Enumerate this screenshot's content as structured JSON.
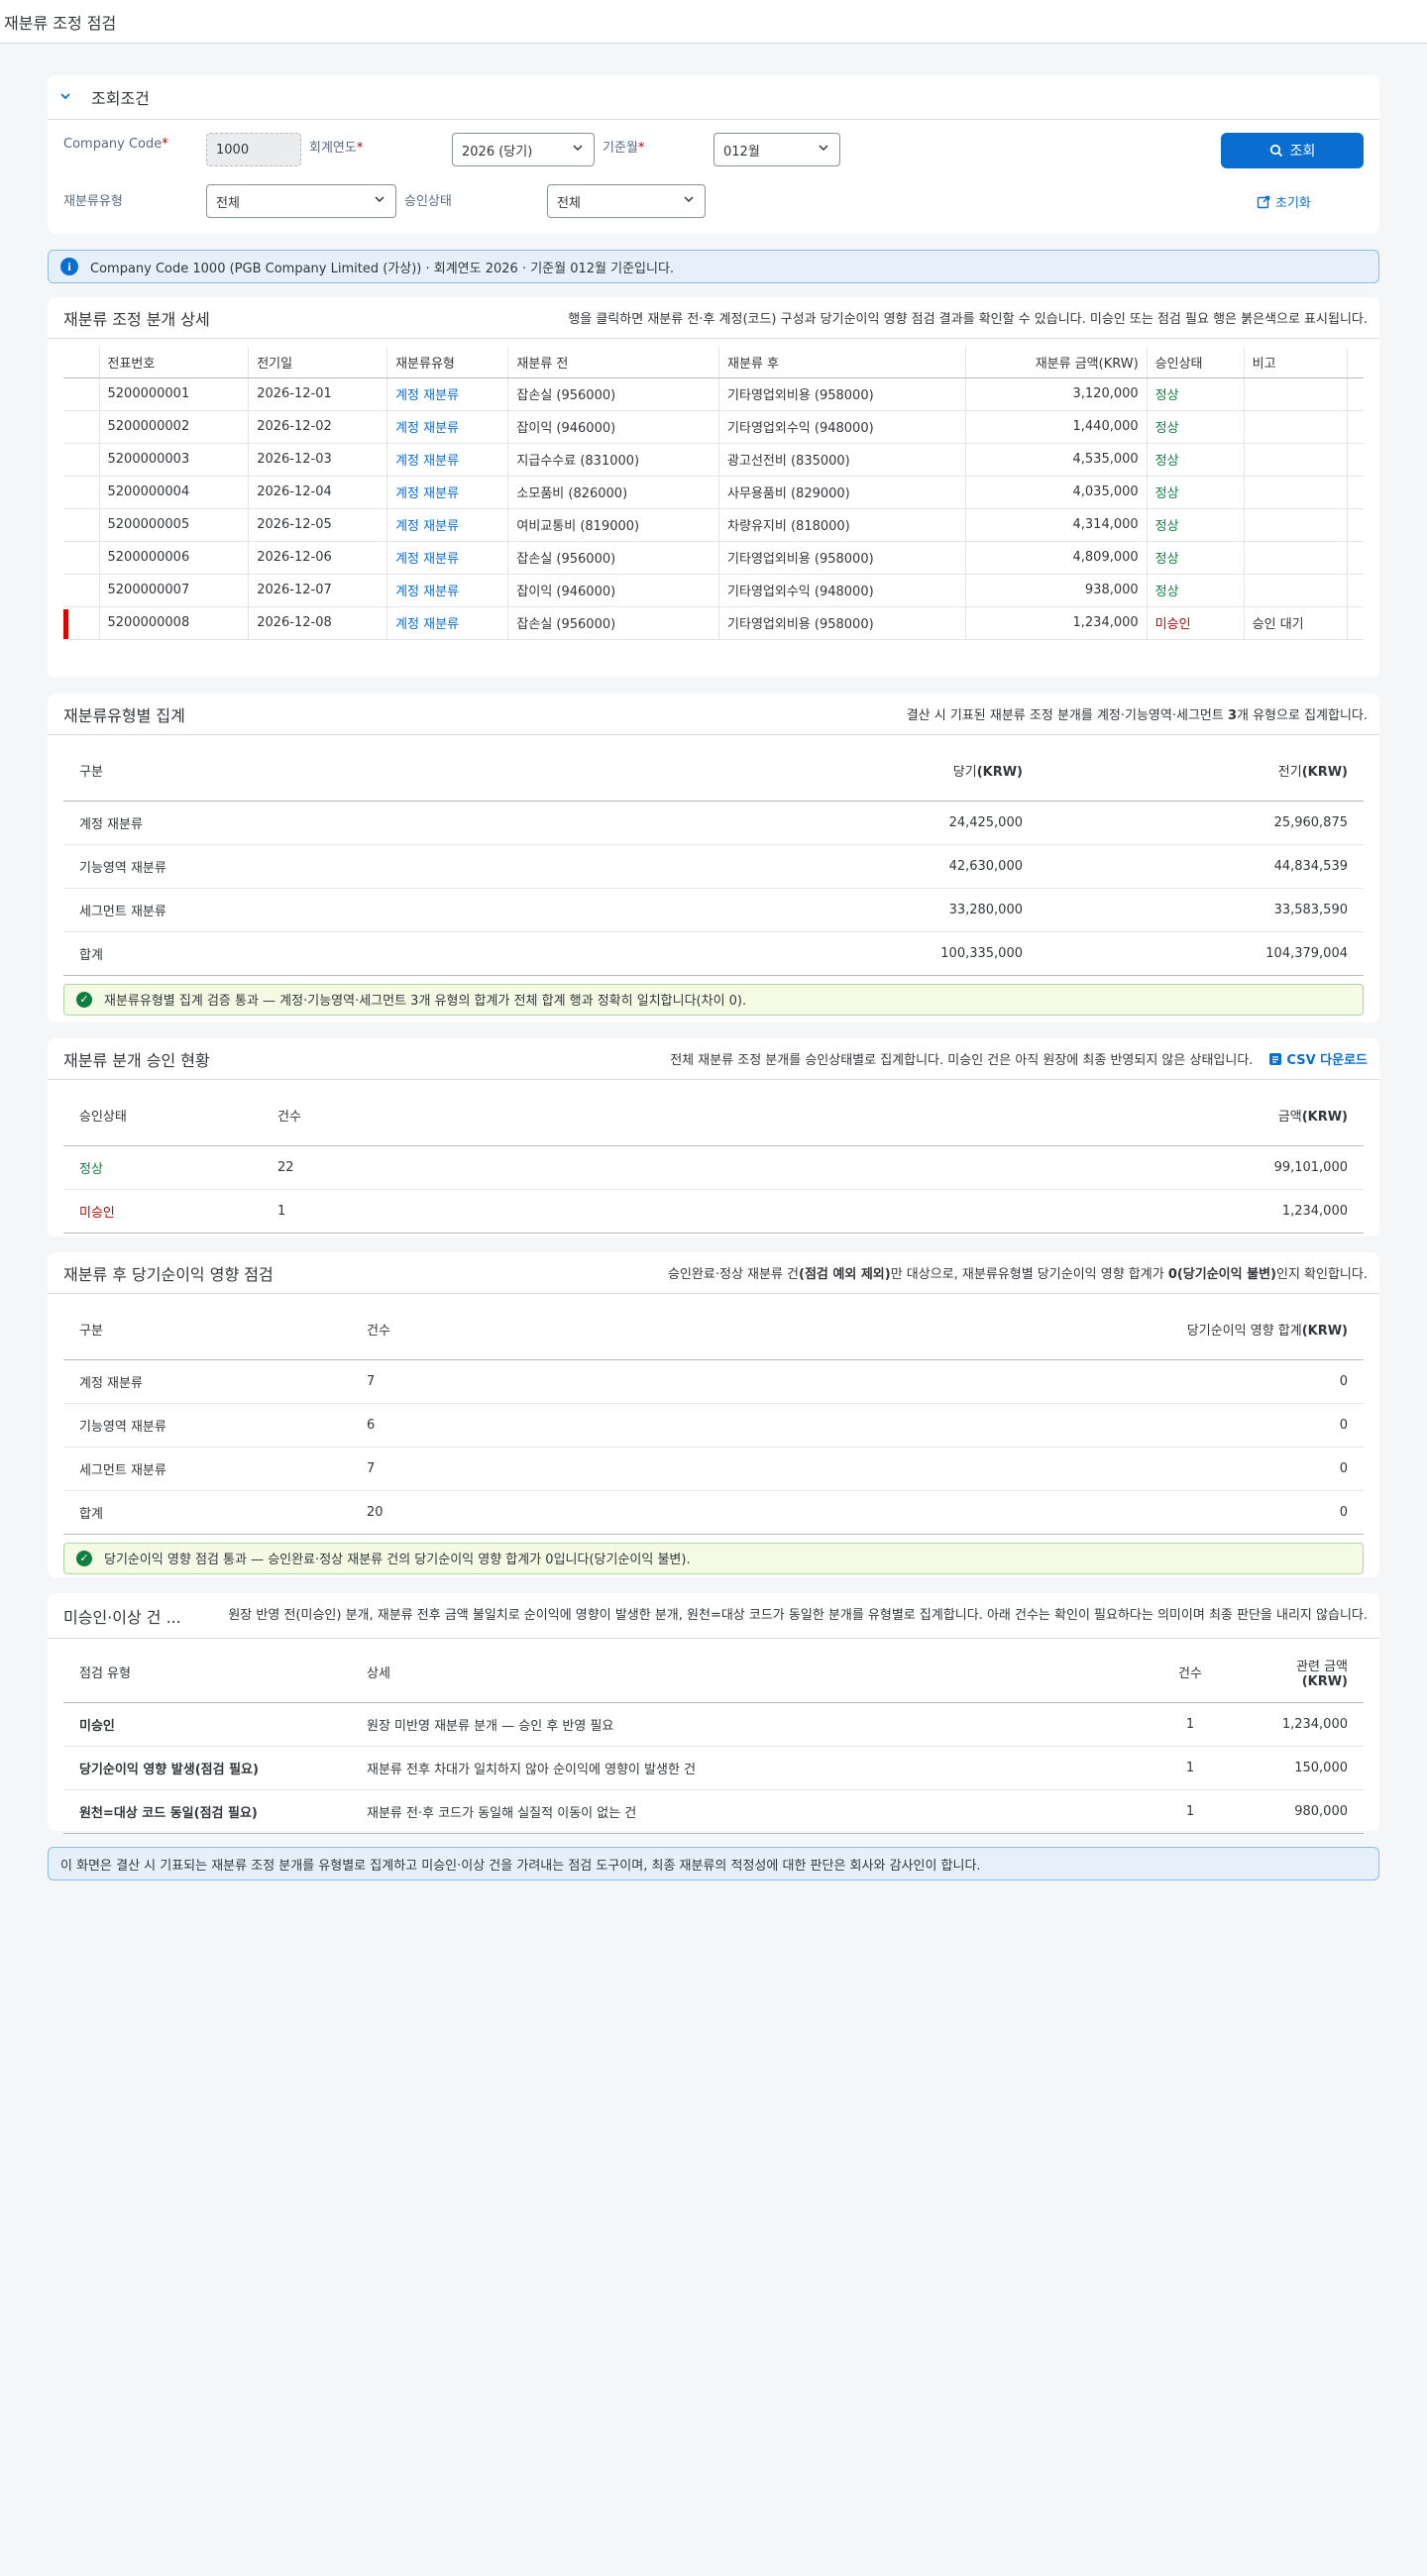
{
  "app": {
    "title": "재분류 조정 점검"
  },
  "filter": {
    "title": "조회조건",
    "company_code_label": "Company Code",
    "company_code_value": "1000",
    "fiscal_year_label": "회계연도",
    "fiscal_year_value": "2026 (당기)",
    "period_label": "기준월",
    "period_value": "012월",
    "type_label": "재분류유형",
    "type_value": "전체",
    "status_label": "승인상태",
    "status_value": "전체",
    "search_button": "조회",
    "reset_button": "초기화",
    "required_mark": "*"
  },
  "info_message": "Company Code 1000 (PGB Company Limited (가상)) · 회계연도 2026 · 기준월 012월 기준입니다.",
  "detail": {
    "title": "재분류 조정 분개 상세",
    "description": "행을 클릭하면 재분류 전·후 계정(코드) 구성과 당기순이익 영향 점검 결과를 확인할 수 있습니다. 미승인 또는 점검 필요 행은 붉은색으로 표시됩니다.",
    "columns": [
      "전표번호",
      "전기일",
      "재분류유형",
      "재분류 전",
      "재분류 후",
      "재분류 금액(KRW)",
      "승인상태",
      "비고"
    ],
    "rows": [
      {
        "doc": "5200000001",
        "date": "2026-12-01",
        "type": "계정 재분류",
        "before": "잡손실 (956000)",
        "after": "기타영업외비용 (958000)",
        "amount": "3,120,000",
        "status": "정상",
        "note": ""
      },
      {
        "doc": "5200000002",
        "date": "2026-12-02",
        "type": "계정 재분류",
        "before": "잡이익 (946000)",
        "after": "기타영업외수익 (948000)",
        "amount": "1,440,000",
        "status": "정상",
        "note": ""
      },
      {
        "doc": "5200000003",
        "date": "2026-12-03",
        "type": "계정 재분류",
        "before": "지급수수료 (831000)",
        "after": "광고선전비 (835000)",
        "amount": "4,535,000",
        "status": "정상",
        "note": ""
      },
      {
        "doc": "5200000004",
        "date": "2026-12-04",
        "type": "계정 재분류",
        "before": "소모품비 (826000)",
        "after": "사무용품비 (829000)",
        "amount": "4,035,000",
        "status": "정상",
        "note": ""
      },
      {
        "doc": "5200000005",
        "date": "2026-12-05",
        "type": "계정 재분류",
        "before": "여비교통비 (819000)",
        "after": "차량유지비 (818000)",
        "amount": "4,314,000",
        "status": "정상",
        "note": ""
      },
      {
        "doc": "5200000006",
        "date": "2026-12-06",
        "type": "계정 재분류",
        "before": "잡손실 (956000)",
        "after": "기타영업외비용 (958000)",
        "amount": "4,809,000",
        "status": "정상",
        "note": ""
      },
      {
        "doc": "5200000007",
        "date": "2026-12-07",
        "type": "계정 재분류",
        "before": "잡이익 (946000)",
        "after": "기타영업외수익 (948000)",
        "amount": "938,000",
        "status": "정상",
        "note": ""
      },
      {
        "doc": "5200000008",
        "date": "2026-12-08",
        "type": "계정 재분류",
        "before": "잡손실 (956000)",
        "after": "기타영업외비용 (958000)",
        "amount": "1,234,000",
        "status": "미승인",
        "note": "승인 대기"
      }
    ]
  },
  "by_type": {
    "title": "재분류유형별 집계",
    "description_pre": "결산 시 기표된 재분류 조정 분개를 계정·기능영역·세그먼트 ",
    "description_bold": "3",
    "description_post": "개 유형으로 집계합니다.",
    "columns": [
      "구분",
      "당기",
      "(KRW)",
      "전기",
      "(KRW)"
    ],
    "rows": [
      {
        "label": "계정 재분류",
        "current": "24,425,000",
        "prior": "25,960,875"
      },
      {
        "label": "기능영역 재분류",
        "current": "42,630,000",
        "prior": "44,834,539"
      },
      {
        "label": "세그먼트 재분류",
        "current": "33,280,000",
        "prior": "33,583,590"
      },
      {
        "label": "합계",
        "current": "100,335,000",
        "prior": "104,379,004"
      }
    ],
    "check": "재분류유형별 집계 검증 통과 — 계정·기능영역·세그먼트 3개 유형의 합계가 전체 합계 행과 정확히 일치합니다(차이 0)."
  },
  "approval": {
    "title": "재분류 분개 승인 현황",
    "description": "전체 재분류 조정 분개를 승인상태별로 집계합니다. 미승인 건은 아직 원장에 최종 반영되지 않은 상태입니다.",
    "csv_label": "CSV 다운로드",
    "columns": [
      "승인상태",
      "건수",
      "금액",
      "(KRW)"
    ],
    "rows": [
      {
        "status": "정상",
        "count": "22",
        "amount": "99,101,000"
      },
      {
        "status": "미승인",
        "count": "1",
        "amount": "1,234,000"
      }
    ]
  },
  "impact": {
    "title": "재분류 후 당기순이익 영향 점검",
    "description_1": "승인완료·정상 재분류 건",
    "description_2": "(점검 예외 제외)",
    "description_3": "만 대상으로, 재분류유형별 당기순이익 영향 합계가 ",
    "description_4": "0",
    "description_5": "(당기순이익 불변)",
    "description_6": "인지 확인합니다.",
    "columns": [
      "구분",
      "건수",
      "당기순이익 영향 합계",
      "(KRW)"
    ],
    "rows": [
      {
        "label": "계정 재분류",
        "count": "7",
        "amount": "0"
      },
      {
        "label": "기능영역 재분류",
        "count": "6",
        "amount": "0"
      },
      {
        "label": "세그먼트 재분류",
        "count": "7",
        "amount": "0"
      },
      {
        "label": "합계",
        "count": "20",
        "amount": "0"
      }
    ],
    "check": "당기순이익 영향 점검 통과 — 승인완료·정상 재분류 건의 당기순이익 영향 합계가 0입니다(당기순이익 불변)."
  },
  "exceptions": {
    "title": "미승인·이상 건 ...",
    "description": "원장 반영 전(미승인) 분개, 재분류 전후 금액 불일치로 순이익에 영향이 발생한 분개, 원천=대상 코드가 동일한 분개를 유형별로 집계합니다. 아래 건수는 확인이 필요하다는 의미이며 최종 판단을 내리지 않습니다.",
    "columns": [
      "점검 유형",
      "상세",
      "건수",
      "관련 금액",
      "(KRW)"
    ],
    "rows": [
      {
        "type": "미승인",
        "detail": "원장 미반영 재분류 분개 — 승인 후 반영 필요",
        "count": "1",
        "amount": "1,234,000"
      },
      {
        "type": "당기순이익 영향 발생(점검 필요)",
        "detail": "재분류 전후 차대가 일치하지 않아 순이익에 영향이 발생한 건",
        "count": "1",
        "amount": "150,000"
      },
      {
        "type": "원천=대상 코드 동일(점검 필요)",
        "detail": "재분류 전·후 코드가 동일해 실질적 이동이 없는 건",
        "count": "1",
        "amount": "980,000"
      }
    ]
  },
  "footer_message": "이 화면은 결산 시 기표되는 재분류 조정 분개를 유형별로 집계하고 미승인·이상 건을 가려내는 점검 도구이며, 최종 재분류의 적정성에 대한 판단은 회사와 감사인이 합니다.",
  "colors": {
    "accent": "#0a6ed1",
    "positive": "#107e3e",
    "negative": "#bb0000",
    "highlight": "#e00000"
  },
  "icons": {
    "collapse": "chevron-down-icon",
    "search": "search-icon",
    "reset": "reset-icon",
    "info": "info-icon",
    "success": "check-circle-icon",
    "download": "csv-icon",
    "dropdown": "dropdown-icon"
  }
}
